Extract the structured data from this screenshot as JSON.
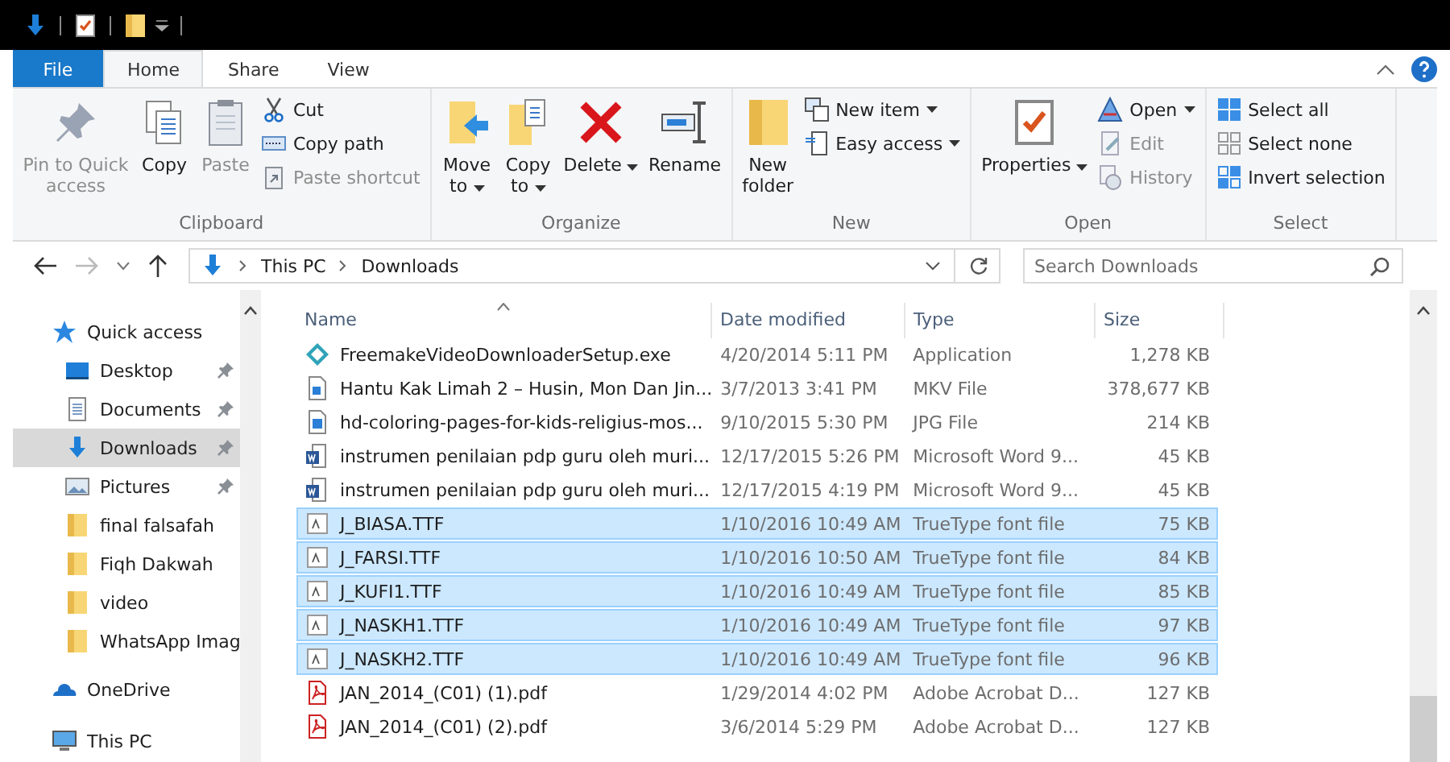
{
  "tabs": [
    {
      "label": "File",
      "kind": "file",
      "selected": false
    },
    {
      "label": "Home",
      "kind": "tab",
      "selected": true
    },
    {
      "label": "Share",
      "kind": "tab",
      "selected": false
    },
    {
      "label": "View",
      "kind": "tab",
      "selected": false
    }
  ],
  "ribbon": [
    {
      "group": "Clipboard",
      "large": [
        {
          "label": "Pin to Quick access",
          "disabled": true,
          "dropdown": false
        },
        {
          "label": "Copy",
          "disabled": false,
          "dropdown": false
        },
        {
          "label": "Paste",
          "disabled": true,
          "dropdown": false
        }
      ],
      "small": [
        {
          "label": "Cut",
          "disabled": false,
          "dropdown": false
        },
        {
          "label": "Copy path",
          "disabled": false,
          "dropdown": false
        },
        {
          "label": "Paste shortcut",
          "disabled": true,
          "dropdown": false
        }
      ]
    },
    {
      "group": "Organize",
      "large": [
        {
          "label": "Move to",
          "disabled": false,
          "dropdown": true
        },
        {
          "label": "Copy to",
          "disabled": false,
          "dropdown": true
        },
        {
          "label": "Delete",
          "disabled": false,
          "dropdown": true
        },
        {
          "label": "Rename",
          "disabled": false,
          "dropdown": false
        }
      ]
    },
    {
      "group": "New",
      "large": [
        {
          "label": "New folder",
          "disabled": false,
          "dropdown": false
        }
      ],
      "small": [
        {
          "label": "New item",
          "disabled": false,
          "dropdown": true
        },
        {
          "label": "Easy access",
          "disabled": false,
          "dropdown": true
        }
      ]
    },
    {
      "group": "Open",
      "large": [
        {
          "label": "Properties",
          "disabled": false,
          "dropdown": true
        }
      ],
      "small": [
        {
          "label": "Open",
          "disabled": false,
          "dropdown": true
        },
        {
          "label": "Edit",
          "disabled": true,
          "dropdown": false
        },
        {
          "label": "History",
          "disabled": true,
          "dropdown": false
        }
      ]
    },
    {
      "group": "Select",
      "small": [
        {
          "label": "Select all",
          "disabled": false,
          "dropdown": false
        },
        {
          "label": "Select none",
          "disabled": false,
          "dropdown": false
        },
        {
          "label": "Invert selection",
          "disabled": false,
          "dropdown": false
        }
      ]
    }
  ],
  "address_bar": {
    "path": [
      "This PC",
      "Downloads"
    ]
  },
  "search": {
    "placeholder": "Search Downloads"
  },
  "nav_pane": [
    {
      "label": "Quick access",
      "pinned": false,
      "selected": false,
      "kind": "section"
    },
    {
      "label": "Desktop",
      "pinned": true,
      "selected": false,
      "kind": "item"
    },
    {
      "label": "Documents",
      "pinned": true,
      "selected": false,
      "kind": "item"
    },
    {
      "label": "Downloads",
      "pinned": true,
      "selected": true,
      "kind": "item"
    },
    {
      "label": "Pictures",
      "pinned": true,
      "selected": false,
      "kind": "item"
    },
    {
      "label": "final falsafah",
      "pinned": false,
      "selected": false,
      "kind": "item"
    },
    {
      "label": "Fiqh Dakwah",
      "pinned": false,
      "selected": false,
      "kind": "item"
    },
    {
      "label": "video",
      "pinned": false,
      "selected": false,
      "kind": "item"
    },
    {
      "label": "WhatsApp Imag",
      "pinned": false,
      "selected": false,
      "kind": "item"
    },
    {
      "label": "OneDrive",
      "pinned": false,
      "selected": false,
      "kind": "section"
    },
    {
      "label": "This PC",
      "pinned": false,
      "selected": false,
      "kind": "section"
    }
  ],
  "table": {
    "columns": [
      "Name",
      "Date modified",
      "Type",
      "Size"
    ],
    "rows": [
      {
        "kind": "app",
        "name": "FreemakeVideoDownloaderSetup.exe",
        "date": "4/20/2014 5:11 PM",
        "type": "Application",
        "size": "1,278 KB",
        "selected": false
      },
      {
        "kind": "video",
        "name": "Hantu Kak Limah 2 – Husin, Mon Dan Jin...",
        "date": "3/7/2013 3:41 PM",
        "type": "MKV File",
        "size": "378,677 KB",
        "selected": false
      },
      {
        "kind": "image",
        "name": "hd-coloring-pages-for-kids-religius-mos...",
        "date": "9/10/2015 5:30 PM",
        "type": "JPG File",
        "size": "214 KB",
        "selected": false
      },
      {
        "kind": "word",
        "name": "instrumen penilaian pdp guru oleh muri...",
        "date": "12/17/2015 5:26 PM",
        "type": "Microsoft Word 9...",
        "size": "45 KB",
        "selected": false
      },
      {
        "kind": "word",
        "name": "instrumen penilaian pdp guru oleh muri...",
        "date": "12/17/2015 4:19 PM",
        "type": "Microsoft Word 9...",
        "size": "45 KB",
        "selected": false
      },
      {
        "kind": "font",
        "name": "J_BIASA.TTF",
        "date": "1/10/2016 10:49 AM",
        "type": "TrueType font file",
        "size": "75 KB",
        "selected": true
      },
      {
        "kind": "font",
        "name": "J_FARSI.TTF",
        "date": "1/10/2016 10:50 AM",
        "type": "TrueType font file",
        "size": "84 KB",
        "selected": true
      },
      {
        "kind": "font",
        "name": "J_KUFI1.TTF",
        "date": "1/10/2016 10:49 AM",
        "type": "TrueType font file",
        "size": "85 KB",
        "selected": true
      },
      {
        "kind": "font",
        "name": "J_NASKH1.TTF",
        "date": "1/10/2016 10:49 AM",
        "type": "TrueType font file",
        "size": "97 KB",
        "selected": true
      },
      {
        "kind": "font",
        "name": "J_NASKH2.TTF",
        "date": "1/10/2016 10:49 AM",
        "type": "TrueType font file",
        "size": "96 KB",
        "selected": true
      },
      {
        "kind": "pdf",
        "name": "JAN_2014_(C01) (1).pdf",
        "date": "1/29/2014 4:02 PM",
        "type": "Adobe Acrobat D...",
        "size": "127 KB",
        "selected": false
      },
      {
        "kind": "pdf",
        "name": "JAN_2014_(C01) (2).pdf",
        "date": "3/6/2014 5:29 PM",
        "type": "Adobe Acrobat D...",
        "size": "127 KB",
        "selected": false
      }
    ]
  }
}
